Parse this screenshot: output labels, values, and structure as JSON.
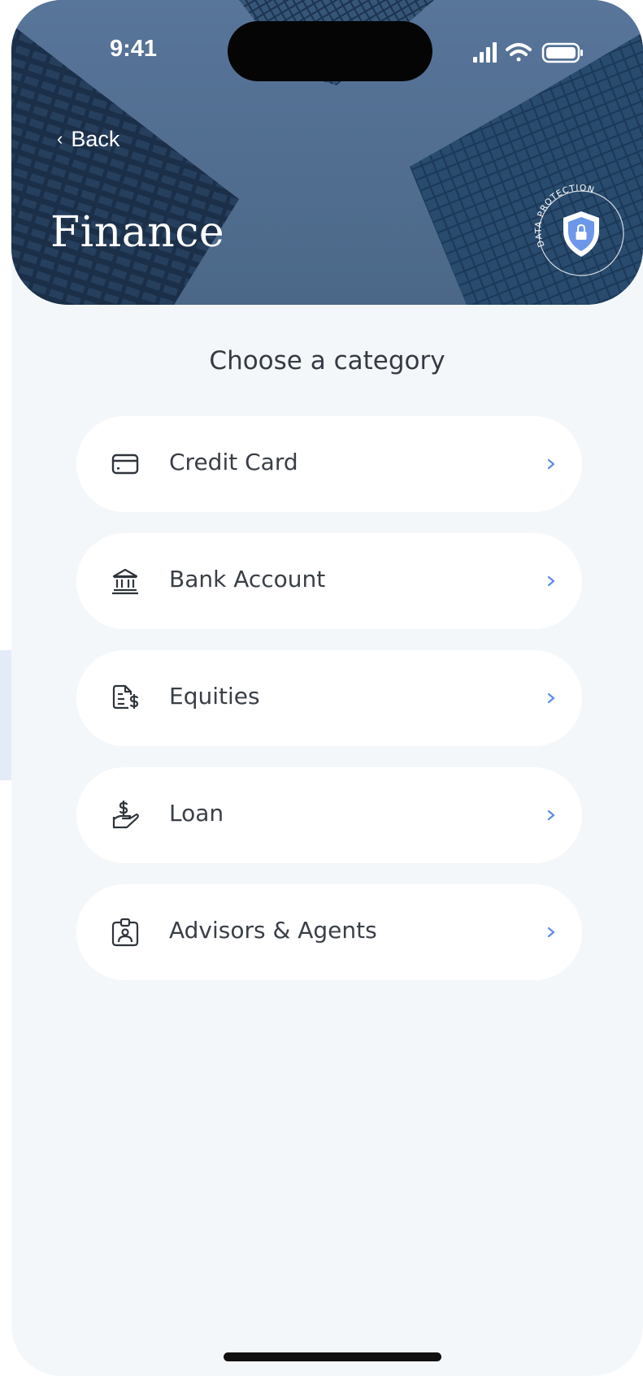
{
  "status_bar": {
    "time": "9:41",
    "icons": [
      "signal-icon",
      "wifi-icon",
      "battery-icon"
    ]
  },
  "header": {
    "back_label": "Back",
    "title": "Finance",
    "badge_text": "DATA PROTECTION",
    "badge_icon": "shield-lock-icon"
  },
  "main": {
    "heading": "Choose a category",
    "categories": [
      {
        "label": "Credit Card",
        "icon": "credit-card-icon"
      },
      {
        "label": "Bank Account",
        "icon": "bank-icon"
      },
      {
        "label": "Equities",
        "icon": "equities-icon"
      },
      {
        "label": "Loan",
        "icon": "loan-hand-icon"
      },
      {
        "label": "Advisors & Agents",
        "icon": "agent-badge-icon"
      }
    ]
  },
  "colors": {
    "accent": "#5b8de8",
    "text_dark": "#3a3f46",
    "background": "#f4f7f9",
    "card": "#ffffff"
  }
}
